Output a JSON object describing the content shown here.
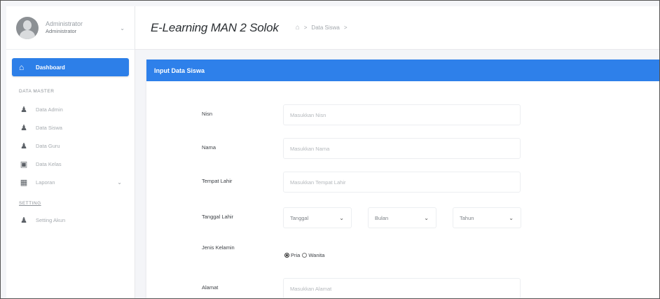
{
  "profile": {
    "name": "Administrator",
    "role": "Administrator"
  },
  "sidebar": {
    "active": {
      "label": "Dashboard",
      "icon": "home-icon"
    },
    "section_master": "DATA MASTER",
    "items": [
      {
        "label": "Data Admin",
        "icon": "user-plus-icon"
      },
      {
        "label": "Data Siswa",
        "icon": "user-plus-icon"
      },
      {
        "label": "Data Guru",
        "icon": "user-plus-icon"
      },
      {
        "label": "Data Kelas",
        "icon": "save-icon"
      },
      {
        "label": "Laporan",
        "icon": "table-icon"
      }
    ],
    "section_settings": "SETTING",
    "settings_item": {
      "label": "Setting Akun",
      "icon": "user-icon"
    }
  },
  "header": {
    "brand": "E-Learning MAN 2 Solok",
    "breadcrumb": "Data Siswa"
  },
  "card": {
    "title": "Input Data Siswa"
  },
  "form": {
    "nisn": {
      "label": "Nisn",
      "placeholder": "Masukkan Nisn"
    },
    "nama": {
      "label": "Nama",
      "placeholder": "Masukkan Nama"
    },
    "tempat_lahir": {
      "label": "Tempat Lahir",
      "placeholder": "Masukkan Tempat Lahir"
    },
    "tanggal_lahir": {
      "label": "Tanggal Lahir",
      "tanggal": "Tanggal",
      "bulan": "Bulan",
      "tahun": "Tahun"
    },
    "jenis_kelamin": {
      "label": "Jenis Kelamin",
      "option_pria": "Pria",
      "option_wanita": "Wanita",
      "selected": "Pria"
    },
    "alamat": {
      "label": "Alamat",
      "placeholder": "Masukkan Alamat"
    }
  },
  "colors": {
    "accent": "#2e80ea",
    "sidebar_bg": "#ffffff",
    "page_bg": "#f4f5f8"
  }
}
